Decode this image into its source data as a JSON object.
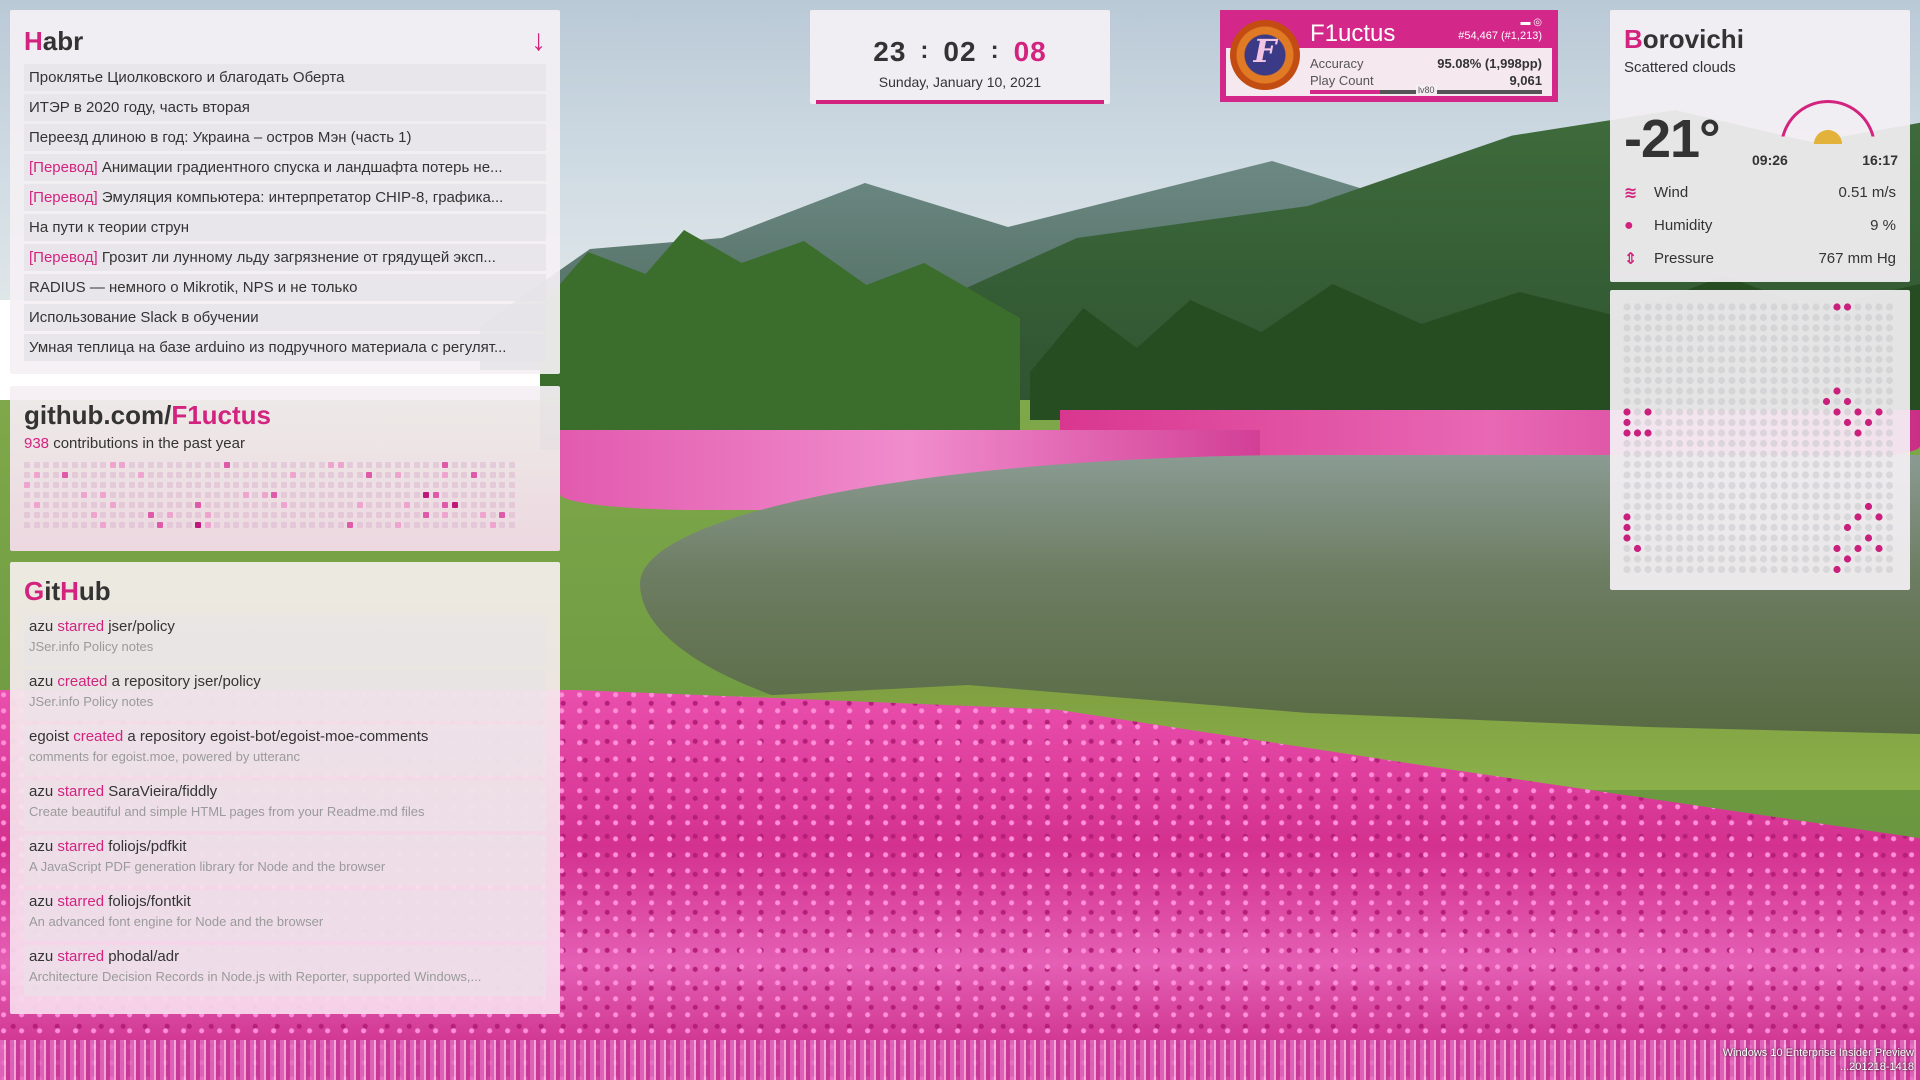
{
  "habr": {
    "title_first": "H",
    "title_rest": "abr",
    "scroll_icon": "arrow-down-icon",
    "items": [
      {
        "tag": "",
        "text": "Проклятье Циолковского и благодать Оберта"
      },
      {
        "tag": "",
        "text": "ИТЭР в 2020 году, часть вторая"
      },
      {
        "tag": "",
        "text": "Переезд длиною в год: Украина – остров Мэн (часть 1)"
      },
      {
        "tag": "[Перевод]",
        "text": "Анимации градиентного спуска и ландшафта потерь не..."
      },
      {
        "tag": "[Перевод]",
        "text": "Эмуляция компьютера: интерпретатор CHIP-8, графика..."
      },
      {
        "tag": "",
        "text": "На пути к теории струн"
      },
      {
        "tag": "[Перевод]",
        "text": "Грозит ли лунному льду загрязнение от грядущей эксп..."
      },
      {
        "tag": "",
        "text": "RADIUS — немного о Mikrotik, NPS и не только"
      },
      {
        "tag": "",
        "text": "Использование Slack в обучении"
      },
      {
        "tag": "",
        "text": "Умная теплица на базе arduino из подручного материала с регулят..."
      }
    ]
  },
  "contributions": {
    "title_prefix": "github.com/",
    "username": "F1uctus",
    "count": "938",
    "suffix": "contributions in the past year"
  },
  "github_feed": {
    "title_g": "G",
    "title_it": "it",
    "title_h": "H",
    "title_ub": "ub",
    "items": [
      {
        "user": "azu",
        "action": "starred",
        "connector": "",
        "repo": "jser/policy",
        "desc": "JSer.info Policy notes"
      },
      {
        "user": "azu",
        "action": "created",
        "connector": "a repository",
        "repo": "jser/policy",
        "desc": "JSer.info Policy notes"
      },
      {
        "user": "egoist",
        "action": "created",
        "connector": "a repository",
        "repo": "egoist-bot/egoist-moe-comments",
        "desc": "comments for egoist.moe, powered by utteranc"
      },
      {
        "user": "azu",
        "action": "starred",
        "connector": "",
        "repo": "SaraVieira/fiddly",
        "desc": "Create beautiful and simple HTML pages from your Readme.md files"
      },
      {
        "user": "azu",
        "action": "starred",
        "connector": "",
        "repo": "foliojs/pdfkit",
        "desc": "A JavaScript PDF generation library for Node and the browser"
      },
      {
        "user": "azu",
        "action": "starred",
        "connector": "",
        "repo": "foliojs/fontkit",
        "desc": "An advanced font engine for Node and the browser"
      },
      {
        "user": "azu",
        "action": "starred",
        "connector": "",
        "repo": "phodal/adr",
        "desc": "Architecture Decision Records in Node.js with Reporter, supported Windows,..."
      }
    ]
  },
  "clock": {
    "hours": "23",
    "minutes": "02",
    "seconds": "08",
    "separator": ":",
    "date": "Sunday, January 10, 2021"
  },
  "osu": {
    "name": "F1uctus",
    "avatar_letter": "F",
    "rank": "#54,467 (#1,213)",
    "accuracy_label": "Accuracy",
    "accuracy_value": "95.08% (1,998pp)",
    "playcount_label": "Play Count",
    "playcount_value": "9,061",
    "level_label": "lv80",
    "level_progress": 0.3
  },
  "weather": {
    "city_first": "B",
    "city_rest": "orovichi",
    "condition": "Scattered clouds",
    "temperature": "-21°",
    "sunrise": "09:26",
    "sunset": "16:17",
    "rows": [
      {
        "icon": "wind-icon",
        "glyph": "≋",
        "label": "Wind",
        "value": "0.51 m/s"
      },
      {
        "icon": "humidity-icon",
        "glyph": "●",
        "label": "Humidity",
        "value": "9 %"
      },
      {
        "icon": "pressure-icon",
        "glyph": "⇕",
        "label": "Pressure",
        "value": "767 mm Hg"
      }
    ]
  },
  "watermark": {
    "line1": "Windows 10 Enterprise Insider Preview",
    "line2": "...201218-1418"
  },
  "colors": {
    "accent": "#d2237f",
    "text": "#333333",
    "muted": "#9a9a9a"
  }
}
